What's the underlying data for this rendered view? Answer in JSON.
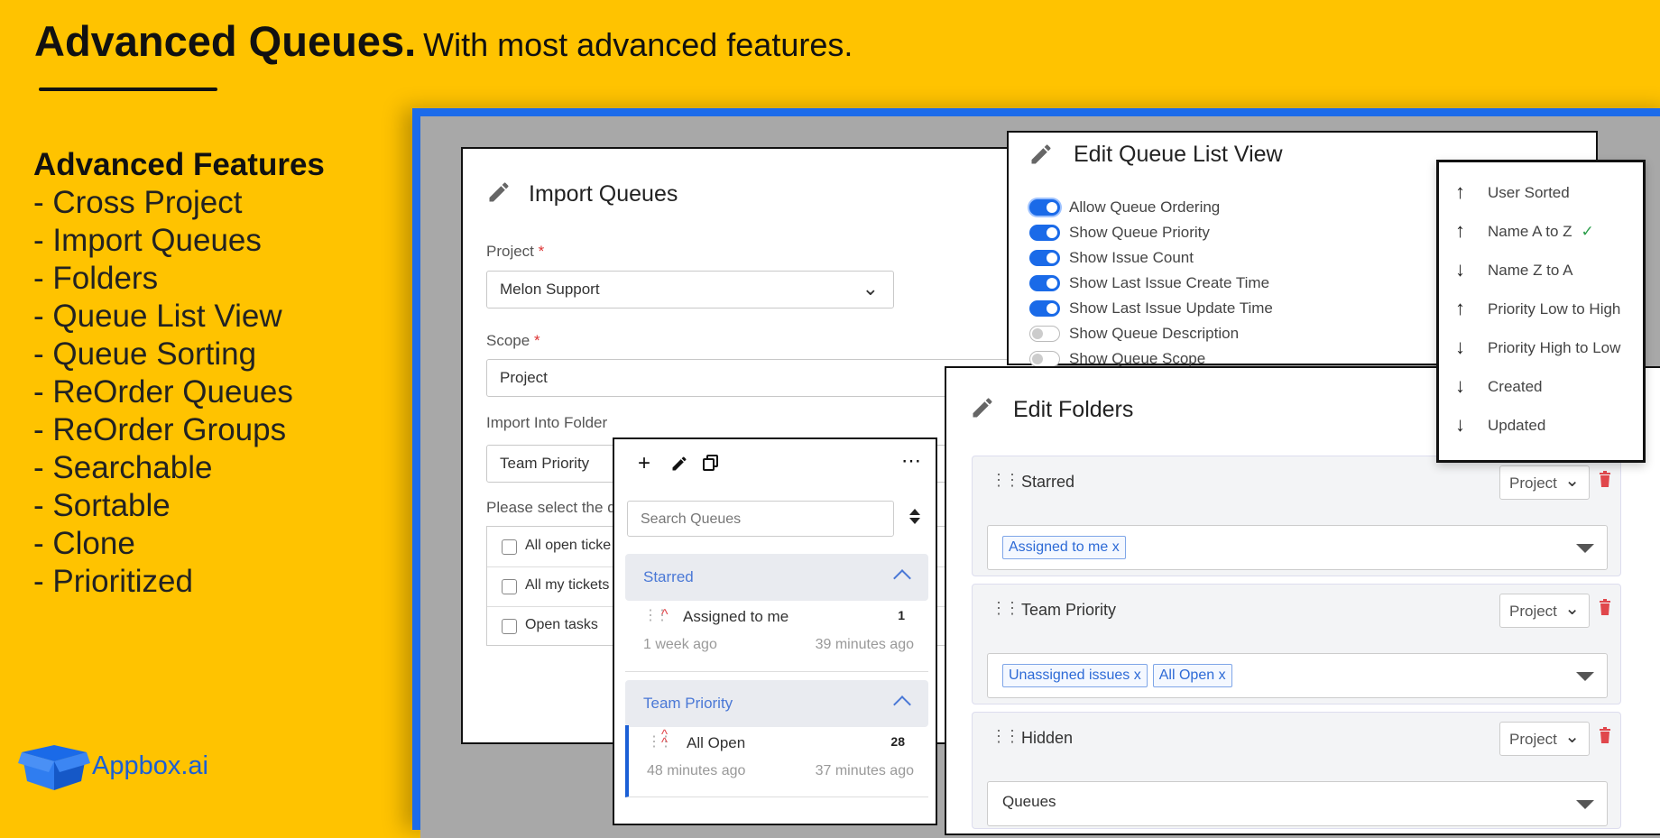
{
  "header": {
    "title_bold": "Advanced Queues.",
    "title_rest": "With most advanced features."
  },
  "features": {
    "title": "Advanced Features",
    "items": [
      "- Cross Project",
      "- Import Queues",
      "- Folders",
      "- Queue List View",
      "- Queue Sorting",
      "- ReOrder Queues",
      "- ReOrder Groups",
      "- Searchable",
      "- Sortable",
      "- Clone",
      "- Prioritized"
    ]
  },
  "logo": {
    "text": "Appbox.ai"
  },
  "import_panel": {
    "title": "Import Queues",
    "project_label": "Project",
    "project_value": "Melon Support",
    "scope_label": "Scope",
    "scope_value": "Project",
    "folder_label": "Import Into Folder",
    "folder_value": "Team Priority",
    "select_text": "Please select the q",
    "options": [
      "All open ticke",
      "All my tickets",
      "Open tasks"
    ]
  },
  "list_view_panel": {
    "title": "Edit Queue List View",
    "toggles": [
      {
        "label": "Allow Queue Ordering",
        "on": true
      },
      {
        "label": "Show Queue Priority",
        "on": true
      },
      {
        "label": "Show Issue Count",
        "on": true
      },
      {
        "label": "Show Last Issue Create Time",
        "on": true
      },
      {
        "label": "Show Last Issue Update Time",
        "on": true
      },
      {
        "label": "Show Queue Description",
        "on": false
      },
      {
        "label": "Show Queue Scope",
        "on": false
      }
    ]
  },
  "sort_menu": {
    "items": [
      {
        "label": "User Sorted",
        "dir": "up",
        "checked": false
      },
      {
        "label": "Name A to Z",
        "dir": "up",
        "checked": true
      },
      {
        "label": "Name Z to A",
        "dir": "down",
        "checked": false
      },
      {
        "label": "Priority Low to High",
        "dir": "up",
        "checked": false
      },
      {
        "label": "Priority High to Low",
        "dir": "down",
        "checked": false
      },
      {
        "label": "Created",
        "dir": "down",
        "checked": false
      },
      {
        "label": "Updated",
        "dir": "down",
        "checked": false
      }
    ],
    "check_glyph": "✓"
  },
  "folders_panel": {
    "title": "Edit Folders",
    "groups": [
      {
        "name": "Starred",
        "scope": "Project",
        "tags": [
          "Assigned to me x"
        ]
      },
      {
        "name": "Team Priority",
        "scope": "Project",
        "tags": [
          "Unassigned issues x",
          "All Open x"
        ]
      },
      {
        "name": "Hidden",
        "scope": "Project",
        "tags_text": "Queues"
      }
    ]
  },
  "queues_panel": {
    "search_placeholder": "Search Queues",
    "sections": [
      {
        "title": "Starred",
        "items": [
          {
            "name": "Assigned to me",
            "count": "1",
            "created": "1 week ago",
            "updated": "39 minutes ago"
          }
        ]
      },
      {
        "title": "Team Priority",
        "items": [
          {
            "name": "All Open",
            "count": "28",
            "created": "48 minutes ago",
            "updated": "37 minutes ago"
          }
        ]
      }
    ]
  }
}
